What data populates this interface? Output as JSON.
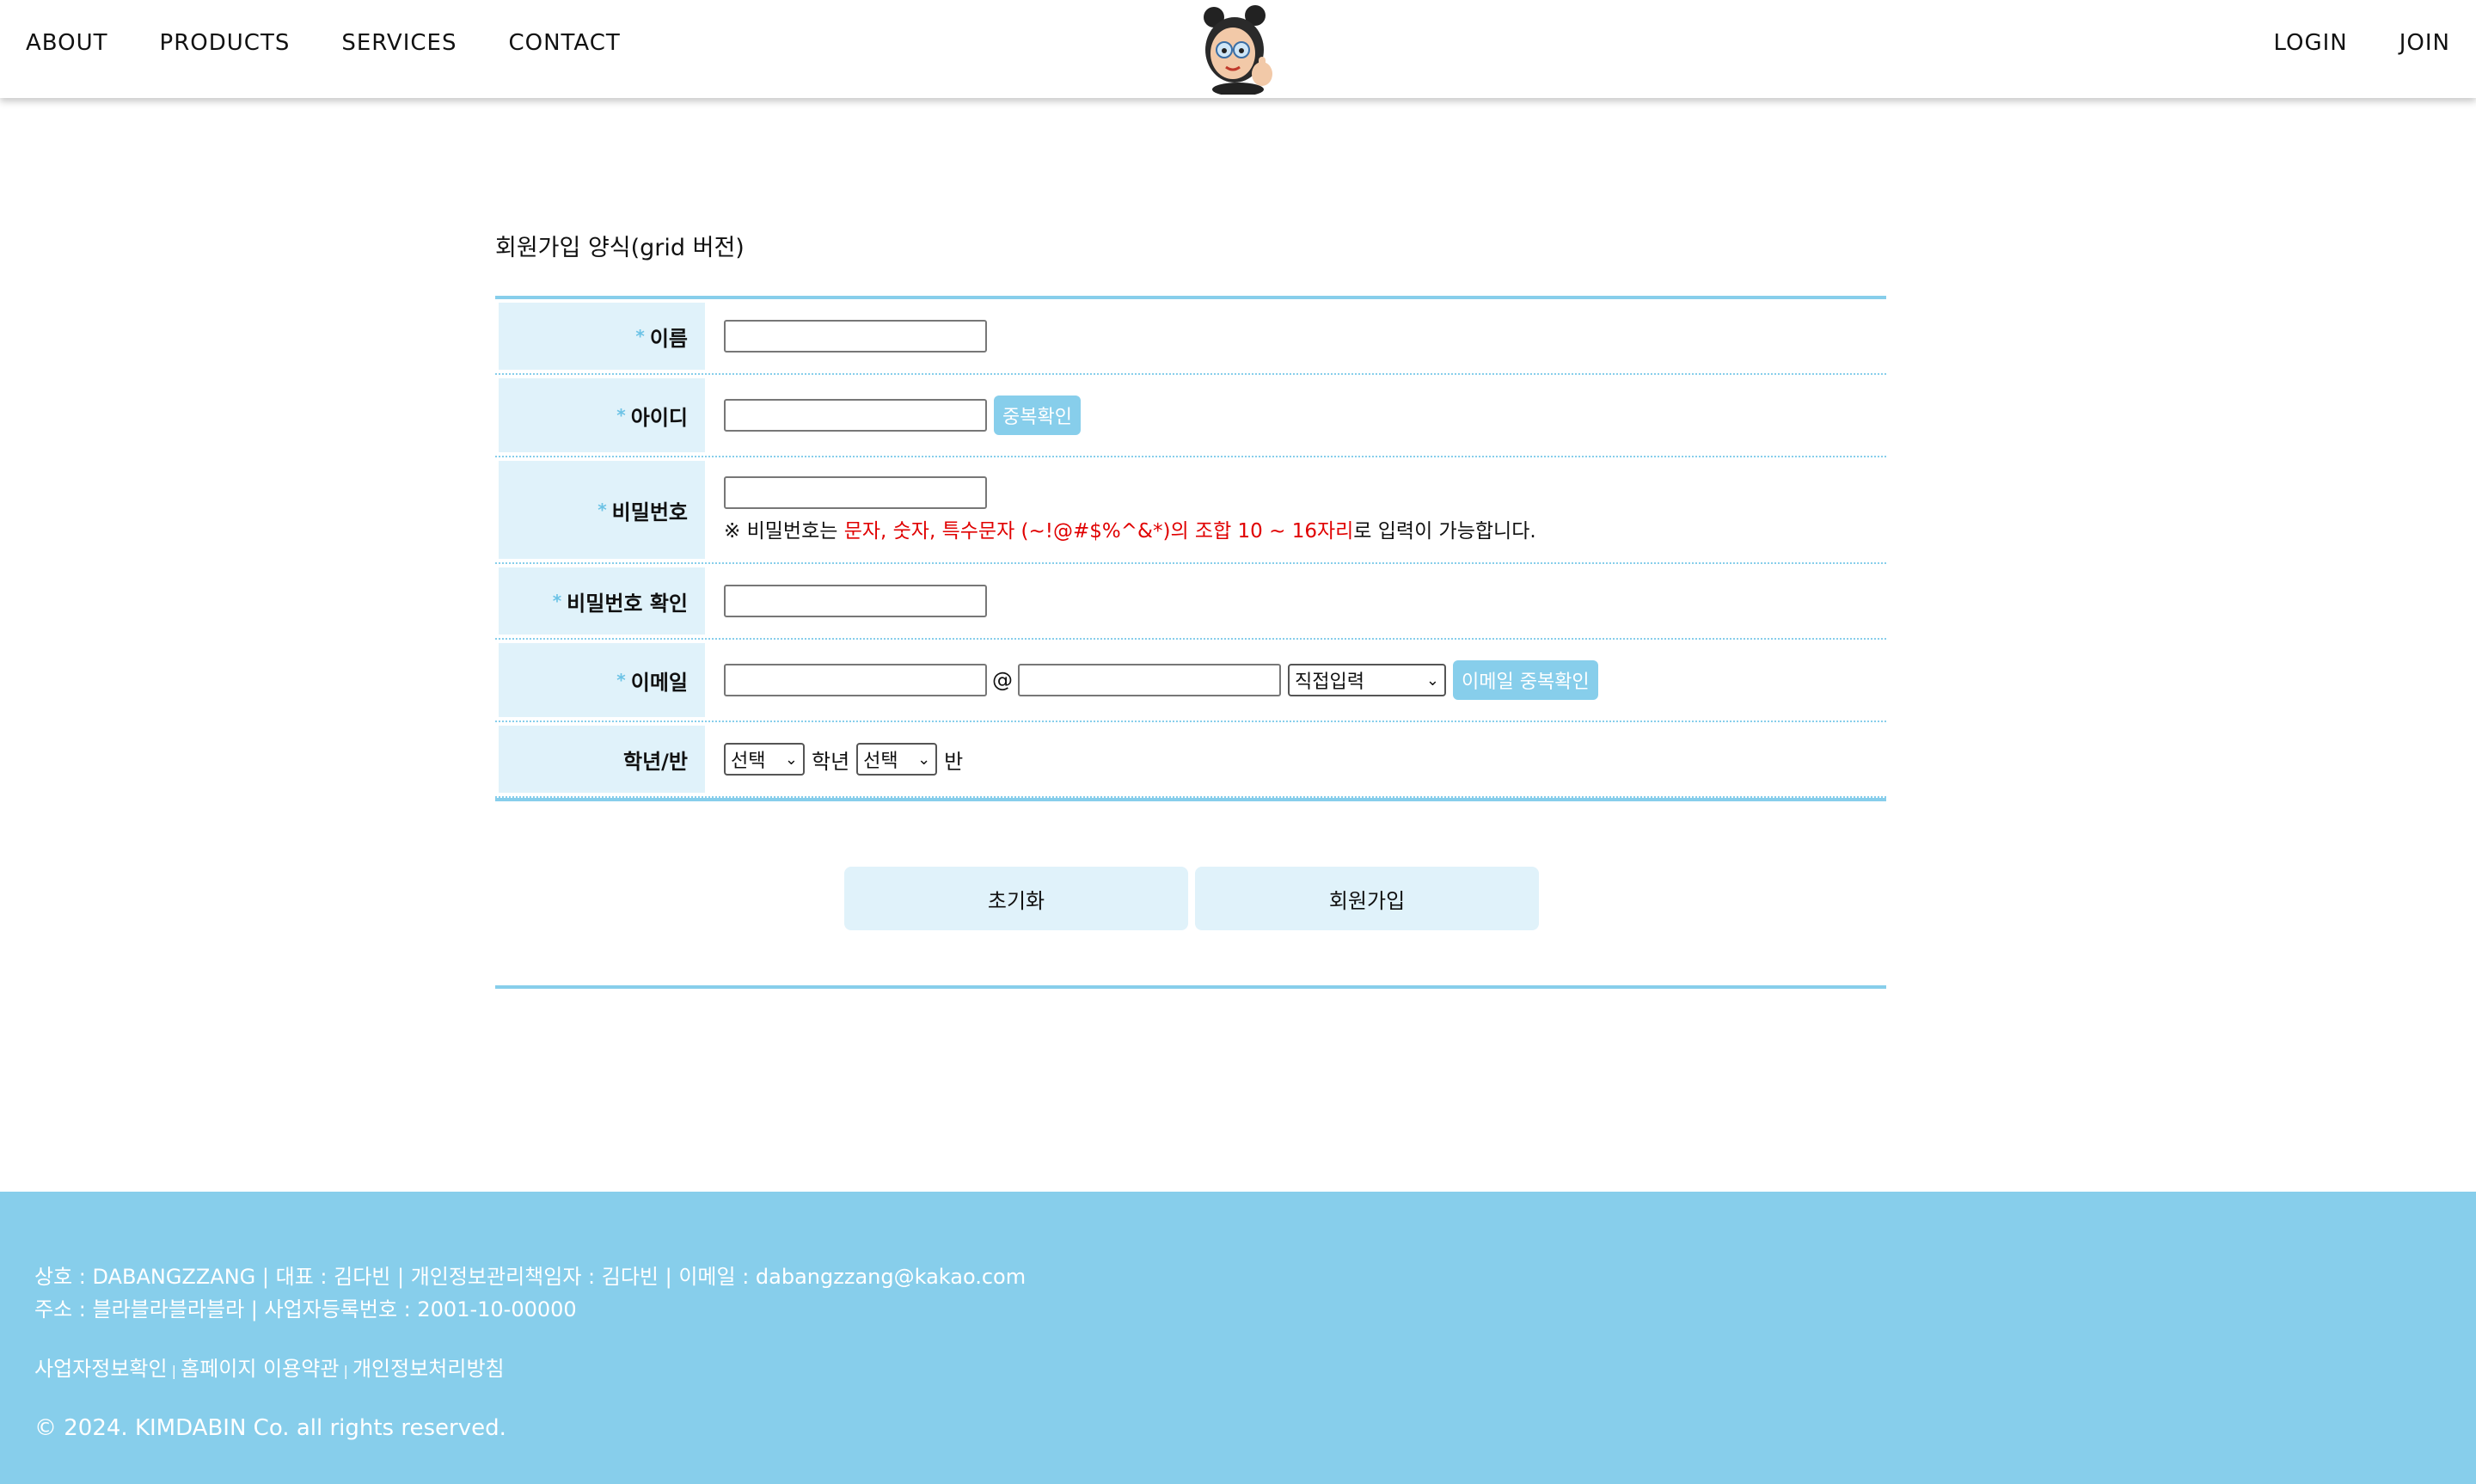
{
  "nav": {
    "left": [
      "ABOUT",
      "PRODUCTS",
      "SERVICES",
      "CONTACT"
    ],
    "right": [
      "LOGIN",
      "JOIN"
    ]
  },
  "form": {
    "title": "회원가입 양식(grid 버전)",
    "rows": {
      "name": {
        "label": "이름",
        "star": "*"
      },
      "id": {
        "label": "아이디",
        "star": "*",
        "button": "중복확인"
      },
      "password": {
        "label": "비밀번호",
        "star": "*",
        "hint_prefix": "※ 비밀번호는 ",
        "hint_red": "문자, 숫자, 특수문자 (~!@#$%^&*)의 조합 10 ~ 16자리",
        "hint_suffix": "로 입력이 가능합니다."
      },
      "password_confirm": {
        "label": "비밀번호 확인",
        "star": "*"
      },
      "email": {
        "label": "이메일",
        "star": "*",
        "at": "@",
        "domain_select": "직접입력",
        "button": "이메일 중복확인"
      },
      "grade_class": {
        "label": "학년/반",
        "grade_select": "선택",
        "grade_unit": "학년",
        "class_select": "선택",
        "class_unit": "반"
      }
    },
    "reset_button": "초기화",
    "submit_button": "회원가입"
  },
  "footer": {
    "line1": "상호 : DABANGZZANG | 대표 : 김다빈 | 개인정보관리책임자 : 김다빈 | 이메일 : dabangzzang@kakao.com",
    "line2": "주소 : 블라블라블라블라 | 사업자등록번호 : 2001-10-00000",
    "links": [
      "사업자정보확인",
      "홈페이지 이용약관",
      "개인정보처리방침"
    ],
    "separator": " | ",
    "copyright": "© 2024. KIMDABIN Co. all rights reserved."
  },
  "colors": {
    "accent": "#87ceeb",
    "label_bg": "#e0f2fa",
    "hint_red": "#e00000"
  },
  "icons": {
    "logo": "avatar-thumbs-up-logo"
  }
}
